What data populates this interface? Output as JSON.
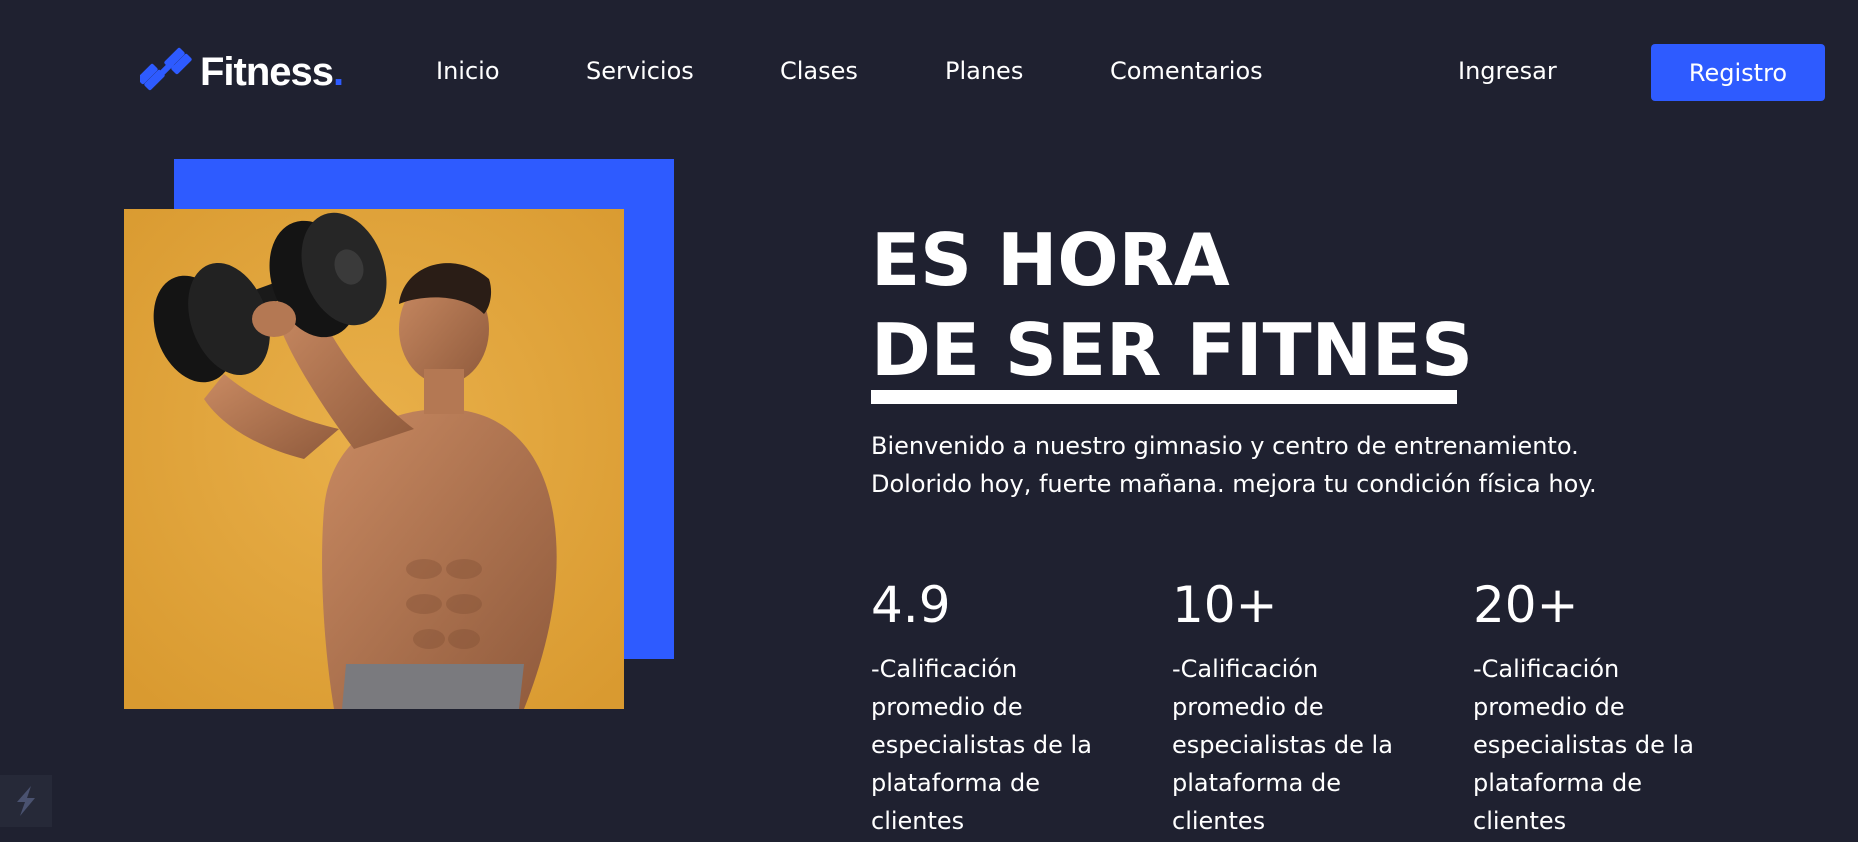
{
  "brand": {
    "name": "Fitness",
    "dot": ".",
    "accent_color": "#2e5bff"
  },
  "nav": {
    "items": [
      {
        "label": "Inicio"
      },
      {
        "label": "Servicios"
      },
      {
        "label": "Clases"
      },
      {
        "label": "Planes"
      },
      {
        "label": "Comentarios"
      }
    ],
    "login_label": "Ingresar",
    "register_label": "Registro"
  },
  "hero": {
    "title_line1": "ES HORA",
    "title_line2": "DE SER FITNES",
    "description_line1": "Bienvenido a nuestro gimnasio y centro de entrenamiento.",
    "description_line2": "Dolorido hoy, fuerte mañana. mejora tu condición física hoy."
  },
  "stats": [
    {
      "value": "4.9",
      "label_lines": [
        "-Calificación",
        "promedio de",
        "especialistas de la",
        "plataforma de",
        "clientes"
      ]
    },
    {
      "value": "10+",
      "label_lines": [
        "-Calificación",
        "promedio de",
        "especialistas de la",
        "plataforma de",
        "clientes"
      ]
    },
    {
      "value": "20+",
      "label_lines": [
        "-Calificación",
        "promedio de",
        "especialistas de la",
        "plataforma de",
        "clientes"
      ]
    }
  ],
  "colors": {
    "background": "#1f2130",
    "accent": "#2e5bff",
    "photo_background": "#e0a43c"
  }
}
